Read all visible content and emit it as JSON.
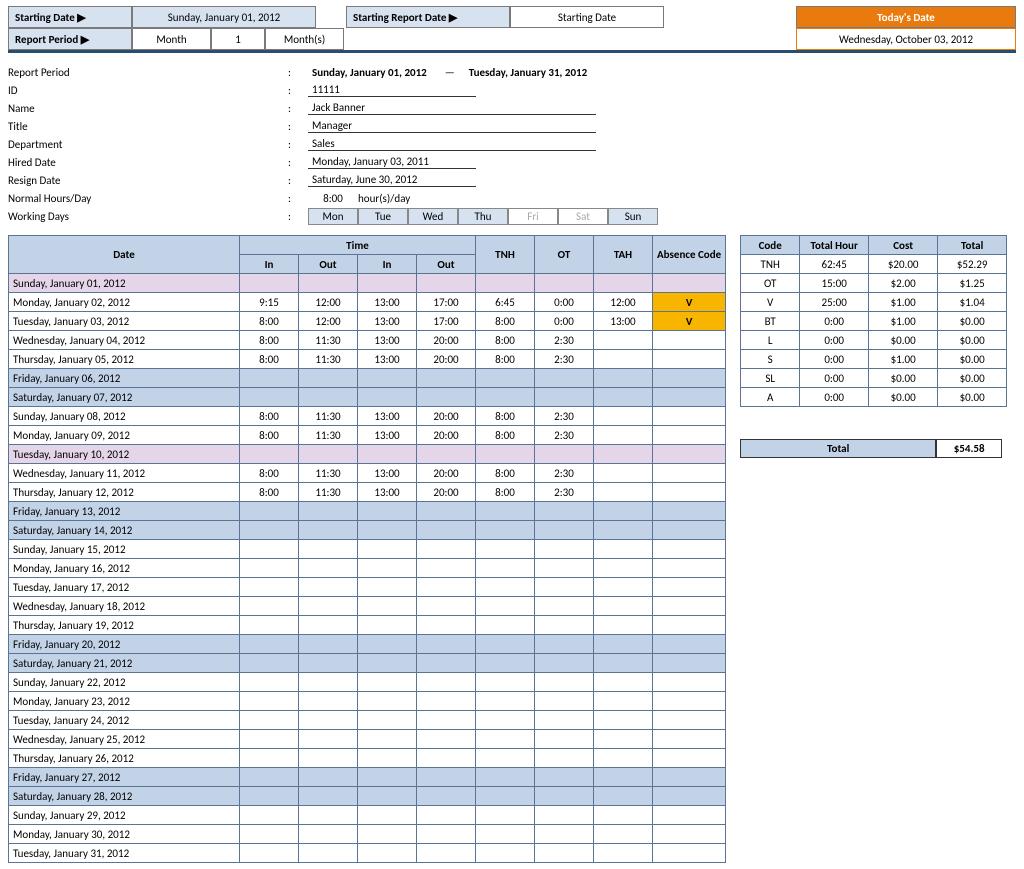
{
  "header": {
    "startDateLbl": "Starting Date ▶",
    "startDate": "Sunday, January 01, 2012",
    "reportPeriodLbl": "Report Period ▶",
    "rpA": "Month",
    "rpB": "1",
    "rpC": "Month(s)",
    "startRepLbl": "Starting Report Date ▶",
    "startRepVal": "Starting Date",
    "todayLbl": "Today's Date",
    "today": "Wednesday, October 03, 2012"
  },
  "meta": {
    "reportPeriodL": "Report Period",
    "reportPeriodV1": "Sunday, January 01, 2012",
    "reportPeriodDash": "—",
    "reportPeriodV2": "Tuesday, January 31, 2012",
    "idL": "ID",
    "idV": "11111",
    "nameL": "Name",
    "nameV": "Jack Banner",
    "titleL": "Title",
    "titleV": "Manager",
    "deptL": "Department",
    "deptV": "Sales",
    "hiredL": "Hired Date",
    "hiredV": "Monday, January 03, 2011",
    "resignL": "Resign Date",
    "resignV": "Saturday, June 30, 2012",
    "nhL": "Normal Hours/Day",
    "nhV": "8:00",
    "nhU": "hour(s)/day",
    "wdL": "Working Days",
    "wd": [
      "Mon",
      "Tue",
      "Wed",
      "Thu",
      "Fri",
      "Sat",
      "Sun"
    ]
  },
  "ts": {
    "h": {
      "date": "Date",
      "time": "Time",
      "in": "In",
      "out": "Out",
      "tnh": "TNH",
      "ot": "OT",
      "tah": "TAH",
      "abs": "Absence Code"
    },
    "rows": [
      {
        "d": "Sunday, January 01, 2012",
        "c": "P"
      },
      {
        "d": "Monday, January 02, 2012",
        "in1": "9:15",
        "out1": "12:00",
        "in2": "13:00",
        "out2": "17:00",
        "tnh": "6:45",
        "ot": "0:00",
        "tah": "12:00",
        "abs": "V",
        "amber": 1
      },
      {
        "d": "Tuesday, January 03, 2012",
        "in1": "8:00",
        "out1": "12:00",
        "in2": "13:00",
        "out2": "17:00",
        "tnh": "8:00",
        "ot": "0:00",
        "tah": "13:00",
        "abs": "V",
        "amber": 1
      },
      {
        "d": "Wednesday, January 04, 2012",
        "in1": "8:00",
        "out1": "11:30",
        "in2": "13:00",
        "out2": "20:00",
        "tnh": "8:00",
        "ot": "2:30"
      },
      {
        "d": "Thursday, January 05, 2012",
        "in1": "8:00",
        "out1": "11:30",
        "in2": "13:00",
        "out2": "20:00",
        "tnh": "8:00",
        "ot": "2:30"
      },
      {
        "d": "Friday, January 06, 2012",
        "c": "B"
      },
      {
        "d": "Saturday, January 07, 2012",
        "c": "B"
      },
      {
        "d": "Sunday, January 08, 2012",
        "in1": "8:00",
        "out1": "11:30",
        "in2": "13:00",
        "out2": "20:00",
        "tnh": "8:00",
        "ot": "2:30"
      },
      {
        "d": "Monday, January 09, 2012",
        "in1": "8:00",
        "out1": "11:30",
        "in2": "13:00",
        "out2": "20:00",
        "tnh": "8:00",
        "ot": "2:30"
      },
      {
        "d": "Tuesday, January 10, 2012",
        "c": "P"
      },
      {
        "d": "Wednesday, January 11, 2012",
        "in1": "8:00",
        "out1": "11:30",
        "in2": "13:00",
        "out2": "20:00",
        "tnh": "8:00",
        "ot": "2:30"
      },
      {
        "d": "Thursday, January 12, 2012",
        "in1": "8:00",
        "out1": "11:30",
        "in2": "13:00",
        "out2": "20:00",
        "tnh": "8:00",
        "ot": "2:30"
      },
      {
        "d": "Friday, January 13, 2012",
        "c": "B"
      },
      {
        "d": "Saturday, January 14, 2012",
        "c": "B"
      },
      {
        "d": "Sunday, January 15, 2012"
      },
      {
        "d": "Monday, January 16, 2012"
      },
      {
        "d": "Tuesday, January 17, 2012"
      },
      {
        "d": "Wednesday, January 18, 2012"
      },
      {
        "d": "Thursday, January 19, 2012"
      },
      {
        "d": "Friday, January 20, 2012",
        "c": "B"
      },
      {
        "d": "Saturday, January 21, 2012",
        "c": "B"
      },
      {
        "d": "Sunday, January 22, 2012"
      },
      {
        "d": "Monday, January 23, 2012"
      },
      {
        "d": "Tuesday, January 24, 2012"
      },
      {
        "d": "Wednesday, January 25, 2012"
      },
      {
        "d": "Thursday, January 26, 2012"
      },
      {
        "d": "Friday, January 27, 2012",
        "c": "B"
      },
      {
        "d": "Saturday, January 28, 2012",
        "c": "B"
      },
      {
        "d": "Sunday, January 29, 2012"
      },
      {
        "d": "Monday, January 30, 2012"
      },
      {
        "d": "Tuesday, January 31, 2012"
      }
    ]
  },
  "sum": {
    "h": {
      "code": "Code",
      "th": "Total Hour",
      "cost": "Cost",
      "tot": "Total"
    },
    "rows": [
      {
        "c": "TNH",
        "h": "62:45",
        "r": "$20.00",
        "t": "$52.29"
      },
      {
        "c": "OT",
        "h": "15:00",
        "r": "$2.00",
        "t": "$1.25"
      },
      {
        "c": "V",
        "h": "25:00",
        "r": "$1.00",
        "t": "$1.04"
      },
      {
        "c": "BT",
        "h": "0:00",
        "r": "$1.00",
        "t": "$0.00"
      },
      {
        "c": "L",
        "h": "0:00",
        "r": "$0.00",
        "t": "$0.00"
      },
      {
        "c": "S",
        "h": "0:00",
        "r": "$1.00",
        "t": "$0.00"
      },
      {
        "c": "SL",
        "h": "0:00",
        "r": "$0.00",
        "t": "$0.00"
      },
      {
        "c": "A",
        "h": "0:00",
        "r": "$0.00",
        "t": "$0.00"
      }
    ],
    "totalL": "Total",
    "totalV": "$54.58"
  }
}
